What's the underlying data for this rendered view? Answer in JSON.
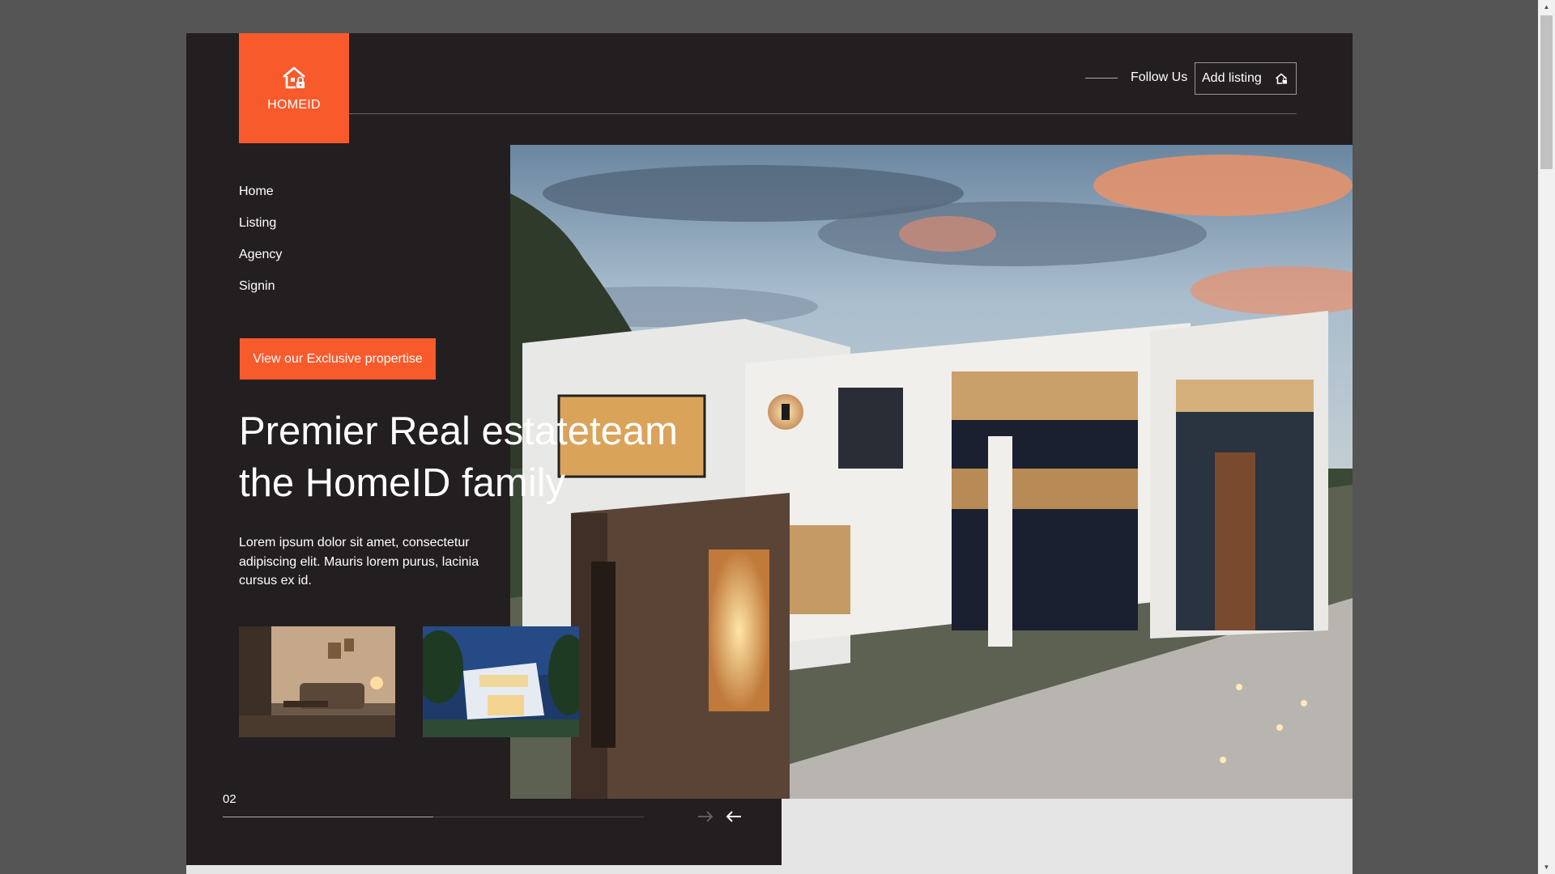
{
  "brand": {
    "name": "HOMEID",
    "logo_icon": "house-lock-icon",
    "accent": "#f95a2c"
  },
  "header": {
    "follow_label": "Follow Us",
    "add_listing_label": "Add listing",
    "add_listing_icon": "house-lock-icon"
  },
  "nav": {
    "items": [
      {
        "label": "Home"
      },
      {
        "label": "Listing"
      },
      {
        "label": "Agency"
      },
      {
        "label": "Signin"
      }
    ]
  },
  "hero": {
    "cta_label": "View our Exclusive propertise",
    "headline_line1": "Premier Real estateteam",
    "headline_line2": "the HomeID family",
    "description": "Lorem ipsum dolor sit amet, consectetur adipiscing elit. Mauris lorem purus, lacinia cursus ex id.",
    "image": "modern-white-villa-at-dusk"
  },
  "thumbnails": [
    {
      "subject": "living-room-interior"
    },
    {
      "subject": "modern-house-night"
    }
  ],
  "slider": {
    "counter": "02",
    "progress_fraction": 0.5,
    "prev_icon": "arrow-right-icon",
    "next_icon": "arrow-left-icon"
  },
  "colors": {
    "dark_bg": "#231f20",
    "page_bg": "#555555",
    "light_bg": "#e5e5e5"
  }
}
